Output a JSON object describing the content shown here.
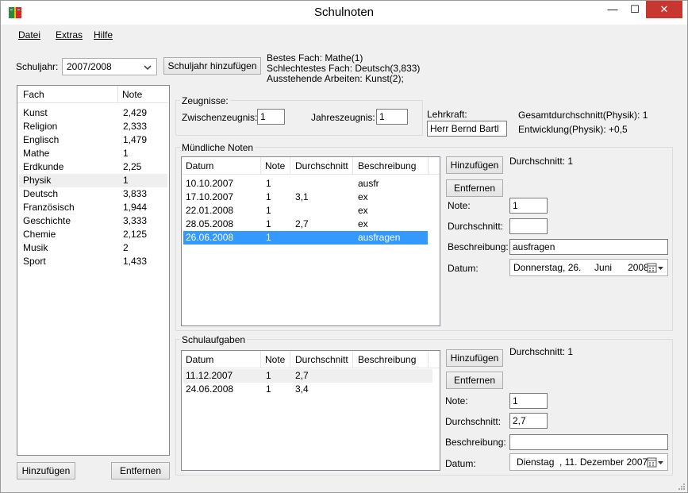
{
  "window": {
    "title": "Schulnoten",
    "min": "—",
    "max": "☐",
    "close": "✕"
  },
  "menu": [
    "Datei",
    "Extras",
    "Hilfe"
  ],
  "toolbar": {
    "schuljahr_label": "Schuljahr:",
    "schuljahr_value": "2007/2008",
    "add_year_button": "Schuljahr hinzufügen"
  },
  "summary": {
    "bestes": "Bestes Fach: Mathe(1)",
    "schlechtestes": "Schlechtestes Fach: Deutsch(3,833)",
    "ausstehend": "Ausstehende Arbeiten: Kunst(2);"
  },
  "subjects": {
    "headers": [
      "Fach",
      "Note"
    ],
    "rows": [
      [
        "Kunst",
        "2,429"
      ],
      [
        "Religion",
        "2,333"
      ],
      [
        "Englisch",
        "1,479"
      ],
      [
        "Mathe",
        "1"
      ],
      [
        "Erdkunde",
        "2,25"
      ],
      [
        "Physik",
        "1"
      ],
      [
        "Deutsch",
        "3,833"
      ],
      [
        "Französisch",
        "1,944"
      ],
      [
        "Geschichte",
        "3,333"
      ],
      [
        "Chemie",
        "2,125"
      ],
      [
        "Musik",
        "2"
      ],
      [
        "Sport",
        "1,433"
      ]
    ],
    "add_button": "Hinzufügen",
    "remove_button": "Entfernen"
  },
  "zeugnisse": {
    "title": "Zeugnisse:",
    "zwischen_label": "Zwischenzeugnis:",
    "zwischen_value": "1",
    "jahres_label": "Jahreszeugnis:",
    "jahres_value": "1"
  },
  "lehrkraft": {
    "label": "Lehrkraft:",
    "value": "Herr Bernd Bartl"
  },
  "gesamt": {
    "durchschnitt": "Gesamtdurchschnitt(Physik): 1",
    "entwicklung": "Entwicklung(Physik): +0,5"
  },
  "muendlich": {
    "title": "Mündliche Noten",
    "headers": [
      "Datum",
      "Note",
      "Durchschnitt",
      "Beschreibung"
    ],
    "rows": [
      [
        "10.10.2007",
        "1",
        "",
        "ausfr"
      ],
      [
        "17.10.2007",
        "1",
        "3,1",
        "ex"
      ],
      [
        "22.01.2008",
        "1",
        "",
        "ex"
      ],
      [
        "28.05.2008",
        "1",
        "2,7",
        "ex"
      ],
      [
        "26.06.2008",
        "1",
        "",
        "ausfragen"
      ]
    ],
    "add_button": "Hinzufügen",
    "remove_button": "Entfernen",
    "durchschnitt_display": "Durchschnitt: 1",
    "note_label": "Note:",
    "note_value": "1",
    "durchschnitt_label": "Durchschnitt:",
    "durchschnitt_value": "",
    "beschreibung_label": "Beschreibung:",
    "beschreibung_value": "ausfragen",
    "datum_label": "Datum:",
    "datum_value": "Donnerstag, 26.     Juni      2008"
  },
  "schulaufgaben": {
    "title": "Schulaufgaben",
    "headers": [
      "Datum",
      "Note",
      "Durchschnitt",
      "Beschreibung"
    ],
    "rows": [
      [
        "11.12.2007",
        "1",
        "2,7",
        ""
      ],
      [
        "24.06.2008",
        "1",
        "3,4",
        ""
      ]
    ],
    "add_button": "Hinzufügen",
    "remove_button": "Entfernen",
    "durchschnitt_display": "Durchschnitt: 1",
    "note_label": "Note:",
    "note_value": "1",
    "durchschnitt_label": "Durchschnitt:",
    "durchschnitt_value": "2,7",
    "beschreibung_label": "Beschreibung:",
    "beschreibung_value": "",
    "datum_label": "Datum:",
    "datum_value": "Dienstag  , 11. Dezember 2007"
  }
}
